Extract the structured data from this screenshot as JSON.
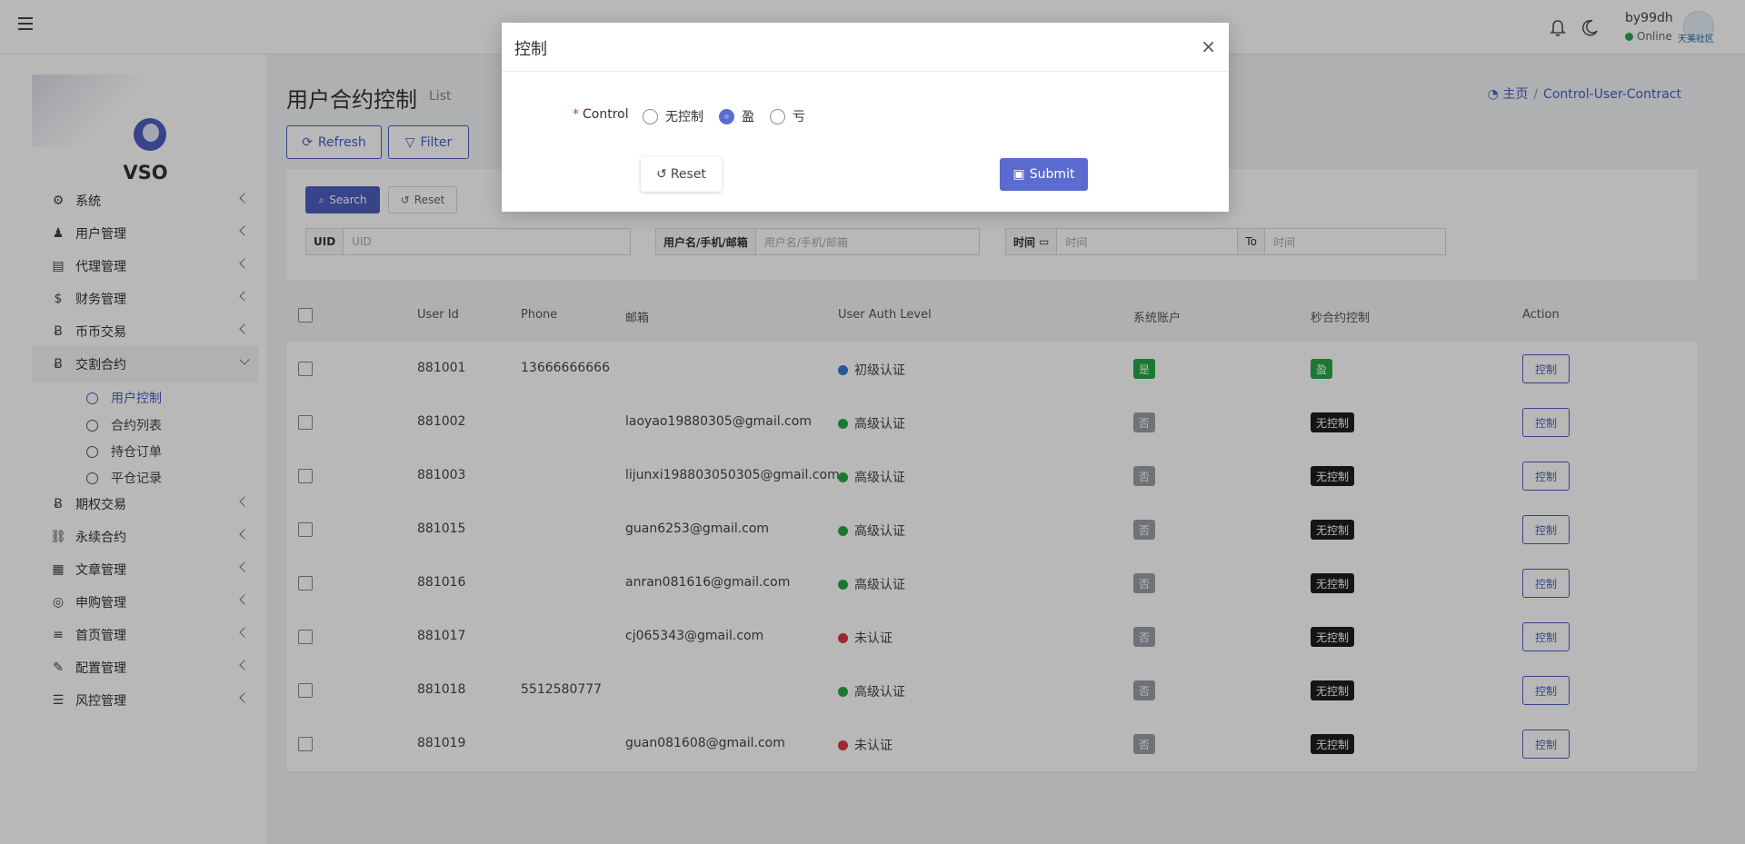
{
  "topbar": {
    "username": "by99dh",
    "status": "Online",
    "avatar_text": "天美社区"
  },
  "sidebar": {
    "brand": "VSO",
    "items": [
      {
        "label": "系统",
        "icon": "gear-icon"
      },
      {
        "label": "用户管理",
        "icon": "user-icon"
      },
      {
        "label": "代理管理",
        "icon": "id-card-icon"
      },
      {
        "label": "财务管理",
        "icon": "dollar-icon"
      },
      {
        "label": "币币交易",
        "icon": "bitcoin-icon"
      },
      {
        "label": "交割合约",
        "icon": "bitcoin-icon"
      },
      {
        "label": "期权交易",
        "icon": "bitcoin-icon"
      },
      {
        "label": "永续合约",
        "icon": "link-icon"
      },
      {
        "label": "文章管理",
        "icon": "newspaper-icon"
      },
      {
        "label": "申购管理",
        "icon": "lifebuoy-icon"
      },
      {
        "label": "首页管理",
        "icon": "bars-icon"
      },
      {
        "label": "配置管理",
        "icon": "wrench-icon"
      },
      {
        "label": "风控管理",
        "icon": "list-icon"
      }
    ],
    "subitems": [
      {
        "label": "用户控制"
      },
      {
        "label": "合约列表"
      },
      {
        "label": "持仓订单"
      },
      {
        "label": "平仓记录"
      }
    ]
  },
  "page": {
    "title": "用户合约控制",
    "subtitle": "List",
    "breadcrumb_home": "主页",
    "breadcrumb_sep": "/",
    "breadcrumb_current": "Control-User-Contract"
  },
  "toolbar": {
    "refresh": "Refresh",
    "filter": "Filter"
  },
  "search": {
    "search_btn": "Search",
    "reset_btn": "Reset",
    "uid_label": "UID",
    "uid_placeholder": "UID",
    "user_label": "用户名/手机/邮箱",
    "user_placeholder": "用户名/手机/邮箱",
    "time_label": "时间",
    "time_placeholder": "时间",
    "to_label": "To",
    "to_placeholder": "时间"
  },
  "table": {
    "headers": {
      "user_id": "User Id",
      "phone": "Phone",
      "email": "邮箱",
      "auth": "User Auth Level",
      "system": "系统账户",
      "control": "秒合约控制",
      "action": "Action"
    },
    "action_label": "控制",
    "rows": [
      {
        "id": "881001",
        "phone": "13666666666",
        "email": "",
        "auth": "初级认证",
        "auth_color": "#3b78c9",
        "system": "是",
        "system_color": "#28a745",
        "control": "盈",
        "control_color": "#28a745"
      },
      {
        "id": "881002",
        "phone": "",
        "email": "laoyao19880305@gmail.com",
        "auth": "高级认证",
        "auth_color": "#28a745",
        "system": "否",
        "system_color": "#9aa0a6",
        "control": "无控制",
        "control_color": "#1e1e1e"
      },
      {
        "id": "881003",
        "phone": "",
        "email": "lijunxi198803050305@gmail.com",
        "auth": "高级认证",
        "auth_color": "#28a745",
        "system": "否",
        "system_color": "#9aa0a6",
        "control": "无控制",
        "control_color": "#1e1e1e"
      },
      {
        "id": "881015",
        "phone": "",
        "email": "guan6253@gmail.com",
        "auth": "高级认证",
        "auth_color": "#28a745",
        "system": "否",
        "system_color": "#9aa0a6",
        "control": "无控制",
        "control_color": "#1e1e1e"
      },
      {
        "id": "881016",
        "phone": "",
        "email": "anran081616@gmail.com",
        "auth": "高级认证",
        "auth_color": "#28a745",
        "system": "否",
        "system_color": "#9aa0a6",
        "control": "无控制",
        "control_color": "#1e1e1e"
      },
      {
        "id": "881017",
        "phone": "",
        "email": "cj065343@gmail.com",
        "auth": "未认证",
        "auth_color": "#dc3545",
        "system": "否",
        "system_color": "#9aa0a6",
        "control": "无控制",
        "control_color": "#1e1e1e"
      },
      {
        "id": "881018",
        "phone": "5512580777",
        "email": "",
        "auth": "高级认证",
        "auth_color": "#28a745",
        "system": "否",
        "system_color": "#9aa0a6",
        "control": "无控制",
        "control_color": "#1e1e1e"
      },
      {
        "id": "881019",
        "phone": "",
        "email": "guan081608@gmail.com",
        "auth": "未认证",
        "auth_color": "#dc3545",
        "system": "否",
        "system_color": "#9aa0a6",
        "control": "无控制",
        "control_color": "#1e1e1e"
      }
    ]
  },
  "modal": {
    "title": "控制",
    "close": "×",
    "field_required": "*",
    "field_label": "Control",
    "options": [
      "无控制",
      "盈",
      "亏"
    ],
    "selected": "盈",
    "reset": "Reset",
    "submit": "Submit"
  },
  "colors": {
    "primary": "#4d5fbf",
    "success": "#28a745",
    "danger": "#dc3545"
  }
}
